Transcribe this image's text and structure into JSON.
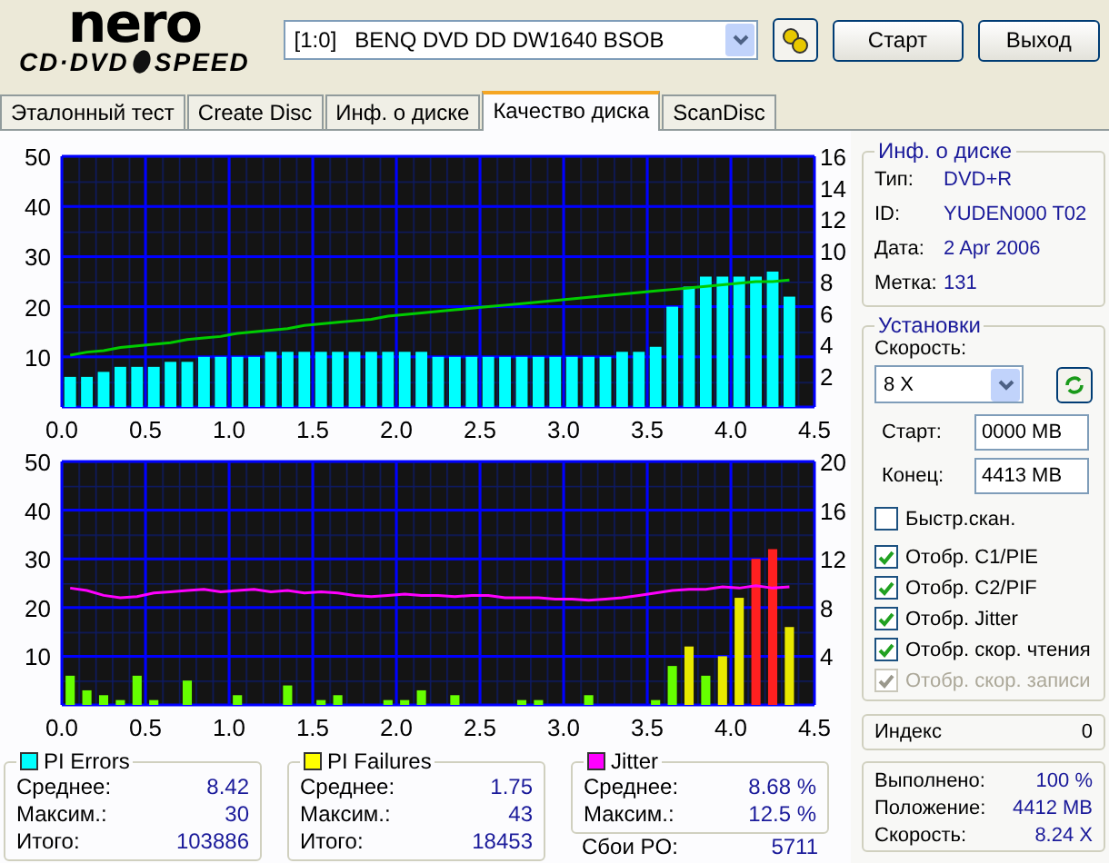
{
  "header": {
    "logo_top": "nero",
    "logo_left": "CD·DVD",
    "logo_right": "SPEED",
    "drive": "[1:0]   BENQ DVD DD DW1640 BSOB",
    "buttons": [
      "Старт",
      "Выход"
    ]
  },
  "tabs": [
    {
      "label": "Эталонный тест",
      "selected": false
    },
    {
      "label": "Create Disc",
      "selected": false
    },
    {
      "label": "Инф. о диске",
      "selected": false
    },
    {
      "label": "Качество диска",
      "selected": true
    },
    {
      "label": "ScanDisc",
      "selected": false
    }
  ],
  "charts": [
    {
      "chart_data": {
        "type": "bar",
        "grid": true,
        "x": [
          0.05,
          0.15,
          0.25,
          0.35,
          0.45,
          0.55,
          0.65,
          0.75,
          0.85,
          0.95,
          1.05,
          1.15,
          1.25,
          1.35,
          1.45,
          1.55,
          1.65,
          1.75,
          1.85,
          1.95,
          2.05,
          2.15,
          2.25,
          2.35,
          2.45,
          2.55,
          2.65,
          2.75,
          2.85,
          2.95,
          3.05,
          3.15,
          3.25,
          3.35,
          3.45,
          3.55,
          3.65,
          3.75,
          3.85,
          3.95,
          4.05,
          4.15,
          4.25,
          4.35
        ],
        "xlim": [
          0,
          4.5
        ],
        "ylim": [
          0,
          50
        ],
        "y2lim": [
          0,
          16
        ],
        "yticks": [
          10,
          20,
          30,
          40,
          50
        ],
        "y2ticks": [
          2,
          4,
          6,
          8,
          10,
          12,
          14,
          16
        ],
        "xticks": [
          {
            "value": 0,
            "label": "0.0"
          },
          {
            "value": 0.5,
            "label": "0.5"
          },
          {
            "value": 1,
            "label": "1.0"
          },
          {
            "value": 1.5,
            "label": "1.5"
          },
          {
            "value": 2,
            "label": "2.0"
          },
          {
            "value": 2.5,
            "label": "2.5"
          },
          {
            "value": 3,
            "label": "3.0"
          },
          {
            "value": 3.5,
            "label": "3.5"
          },
          {
            "value": 4,
            "label": "4.0"
          },
          {
            "value": 4.5,
            "label": "4.5"
          }
        ],
        "series": [
          {
            "color": "#00ffff",
            "values": [
              6,
              6,
              7,
              8,
              8,
              8,
              9,
              9,
              10,
              10,
              10,
              10,
              11,
              11,
              11,
              11,
              11,
              11,
              11,
              11,
              11,
              11,
              10,
              10,
              10,
              10,
              10,
              10,
              10,
              10,
              10,
              10,
              10,
              11,
              11,
              12,
              20,
              24,
              26,
              26,
              26,
              26,
              27,
              22
            ]
          },
          {
            "type": "line",
            "axis": "y2",
            "color": "#00cc00",
            "values": [
              3.3,
              3.5,
              3.6,
              3.8,
              3.9,
              4.0,
              4.1,
              4.3,
              4.4,
              4.5,
              4.7,
              4.8,
              4.9,
              5.0,
              5.2,
              5.3,
              5.4,
              5.5,
              5.6,
              5.8,
              5.9,
              6.0,
              6.1,
              6.2,
              6.3,
              6.4,
              6.5,
              6.6,
              6.7,
              6.8,
              6.9,
              7.0,
              7.1,
              7.2,
              7.3,
              7.4,
              7.5,
              7.6,
              7.7,
              7.8,
              7.9,
              8.0,
              8.0,
              8.1
            ]
          }
        ]
      }
    },
    {
      "chart_data": {
        "type": "bar",
        "grid": true,
        "x": [
          0.05,
          0.15,
          0.25,
          0.35,
          0.45,
          0.55,
          0.65,
          0.75,
          0.85,
          0.95,
          1.05,
          1.15,
          1.25,
          1.35,
          1.45,
          1.55,
          1.65,
          1.75,
          1.85,
          1.95,
          2.05,
          2.15,
          2.25,
          2.35,
          2.45,
          2.55,
          2.65,
          2.75,
          2.85,
          2.95,
          3.05,
          3.15,
          3.25,
          3.35,
          3.45,
          3.55,
          3.65,
          3.75,
          3.85,
          3.95,
          4.05,
          4.15,
          4.25,
          4.35
        ],
        "xlim": [
          0,
          4.5
        ],
        "ylim": [
          0,
          50
        ],
        "y2lim": [
          0,
          20
        ],
        "yticks": [
          10,
          20,
          30,
          40,
          50
        ],
        "y2ticks": [
          4,
          8,
          12,
          16,
          20
        ],
        "xticks": [
          {
            "value": 0,
            "label": "0.0"
          },
          {
            "value": 0.5,
            "label": "0.5"
          },
          {
            "value": 1,
            "label": "1.0"
          },
          {
            "value": 1.5,
            "label": "1.5"
          },
          {
            "value": 2,
            "label": "2.0"
          },
          {
            "value": 2.5,
            "label": "2.5"
          },
          {
            "value": 3,
            "label": "3.0"
          },
          {
            "value": 3.5,
            "label": "3.5"
          },
          {
            "value": 4,
            "label": "4.0"
          },
          {
            "value": 4.5,
            "label": "4.5"
          }
        ],
        "series": [
          {
            "color": "#66ff00",
            "values": [
              6,
              3,
              2,
              1,
              6,
              1,
              null,
              5,
              null,
              null,
              2,
              null,
              null,
              4,
              null,
              1,
              2,
              null,
              null,
              1,
              1,
              3,
              null,
              2,
              null,
              null,
              null,
              1,
              1,
              null,
              null,
              2,
              null,
              null,
              null,
              1,
              8,
              null,
              6,
              null,
              null,
              null,
              null,
              null
            ]
          },
          {
            "color": "#e8e800",
            "values": [
              null,
              null,
              null,
              null,
              null,
              null,
              null,
              null,
              null,
              null,
              null,
              null,
              null,
              null,
              null,
              null,
              null,
              null,
              null,
              null,
              null,
              null,
              null,
              null,
              null,
              null,
              null,
              null,
              null,
              null,
              null,
              null,
              null,
              null,
              null,
              null,
              null,
              12,
              null,
              10,
              22,
              null,
              null,
              16
            ]
          },
          {
            "color": "#ff2020",
            "values": [
              null,
              null,
              null,
              null,
              null,
              null,
              null,
              null,
              null,
              null,
              null,
              null,
              null,
              null,
              null,
              null,
              null,
              null,
              null,
              null,
              null,
              null,
              null,
              null,
              null,
              null,
              null,
              null,
              null,
              null,
              null,
              null,
              null,
              null,
              null,
              null,
              null,
              null,
              null,
              null,
              null,
              30,
              32,
              null
            ]
          },
          {
            "type": "line",
            "axis": "y2",
            "color": "#ff00ff",
            "values": [
              9.6,
              9.4,
              9.0,
              8.8,
              8.9,
              9.2,
              9.3,
              9.4,
              9.5,
              9.3,
              9.4,
              9.5,
              9.3,
              9.4,
              9.2,
              9.3,
              9.2,
              9.0,
              8.9,
              9.0,
              9.1,
              9.0,
              9.0,
              8.9,
              9.0,
              9.0,
              8.8,
              8.8,
              8.8,
              8.7,
              8.7,
              8.6,
              8.7,
              8.8,
              9.0,
              9.2,
              9.4,
              9.5,
              9.5,
              9.7,
              9.6,
              9.8,
              9.6,
              9.7
            ]
          }
        ]
      }
    }
  ],
  "stats": [
    {
      "title": "PI Errors",
      "color": "#00ffff",
      "rows": [
        {
          "label": "Среднее:",
          "value": "8.42"
        },
        {
          "label": "Максим.:",
          "value": "30"
        },
        {
          "label": "Итого:",
          "value": "103886"
        }
      ]
    },
    {
      "title": "PI Failures",
      "color": "#ffff00",
      "rows": [
        {
          "label": "Среднее:",
          "value": "1.75"
        },
        {
          "label": "Максим.:",
          "value": "43"
        },
        {
          "label": "Итого:",
          "value": "18453"
        }
      ]
    },
    {
      "title": "Jitter",
      "color": "#ff00ff",
      "rows": [
        {
          "label": "Среднее:",
          "value": "8.68 %"
        },
        {
          "label": "Максим.:",
          "value": "12.5 %"
        }
      ]
    }
  ],
  "po_failures": {
    "label": "Сбои PO:",
    "value": "5711"
  },
  "disc_info": {
    "title": "Инф. о диске",
    "rows": [
      {
        "label": "Тип:",
        "value": "DVD+R"
      },
      {
        "label": "ID:",
        "value": "YUDEN000 T02"
      },
      {
        "label": "Дата:",
        "value": "2 Apr 2006"
      },
      {
        "label": "Метка:",
        "value": "131"
      }
    ]
  },
  "settings": {
    "title": "Установки",
    "speed_label": "Скорость:",
    "speed_value": "8 X",
    "fields": [
      {
        "label": "Старт:",
        "value": "0000 MB"
      },
      {
        "label": "Конец:",
        "value": "4413 MB"
      }
    ],
    "checkboxes": [
      {
        "label": "Быстр.скан.",
        "checked": false,
        "disabled": false
      },
      {
        "label": "Отобр. C1/PIE",
        "checked": true,
        "disabled": false
      },
      {
        "label": "Отобр. C2/PIF",
        "checked": true,
        "disabled": false
      },
      {
        "label": "Отобр. Jitter",
        "checked": true,
        "disabled": false
      },
      {
        "label": "Отобр. скор. чтения",
        "checked": true,
        "disabled": false
      },
      {
        "label": "Отобр. скор. записи",
        "checked": true,
        "disabled": true
      }
    ]
  },
  "index": {
    "label": "Индекс",
    "value": "0"
  },
  "progress": [
    {
      "label": "Выполнено:",
      "value": "100 %"
    },
    {
      "label": "Положение:",
      "value": "4412 MB"
    },
    {
      "label": "Скорость:",
      "value": "8.24 X"
    }
  ]
}
